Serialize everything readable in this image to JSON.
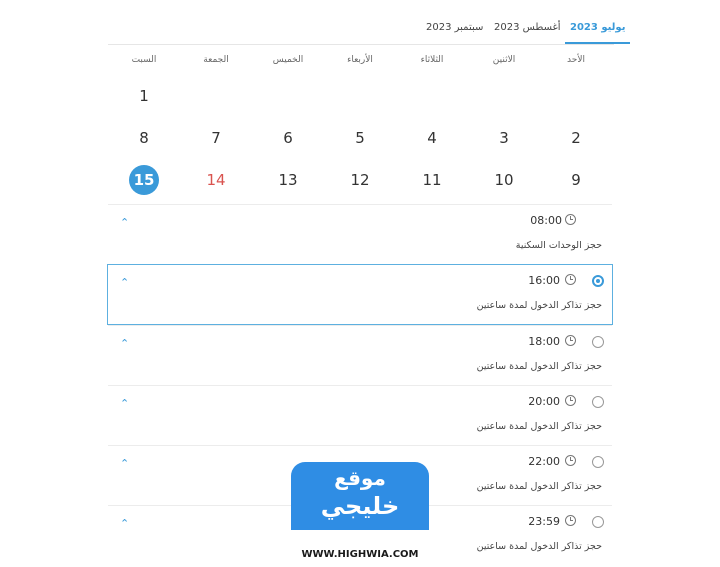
{
  "tabs": [
    {
      "label": "يوليو 2023",
      "active": true
    },
    {
      "label": "أغسطس 2023",
      "active": false
    },
    {
      "label": "سبتمبر 2023",
      "active": false
    }
  ],
  "weekdays": [
    "الأحد",
    "الاثنين",
    "الثلاثاء",
    "الأربعاء",
    "الخميس",
    "الجمعة",
    "السبت"
  ],
  "days": {
    "row1": [
      "1"
    ],
    "row2": [
      "2",
      "3",
      "4",
      "5",
      "6",
      "7",
      "8"
    ],
    "row3": [
      "9",
      "10",
      "11",
      "12",
      "13",
      "14",
      "15"
    ]
  },
  "today": "15",
  "slots": [
    {
      "time": "08:00",
      "desc": "حجز الوحدات السكنية",
      "selected": false,
      "radio": false
    },
    {
      "time": "16:00",
      "desc": "حجز تذاكر الدخول لمدة ساعتين",
      "selected": true,
      "radio": true
    },
    {
      "time": "18:00",
      "desc": "حجز تذاكر الدخول لمدة ساعتين",
      "selected": false,
      "radio": true
    },
    {
      "time": "20:00",
      "desc": "حجز تذاكر الدخول لمدة ساعتين",
      "selected": false,
      "radio": true
    },
    {
      "time": "22:00",
      "desc": "حجز تذاكر الدخول لمدة ساعتين",
      "selected": false,
      "radio": true
    },
    {
      "time": "23:59",
      "desc": "حجز تذاكر الدخول لمدة ساعتين",
      "selected": false,
      "radio": true
    }
  ],
  "watermark": {
    "line1": "موقع",
    "line2": "خليجي",
    "url": "WWW.HIGHWIA.COM"
  },
  "colors": {
    "accent": "#3a9ad9",
    "red_day": "#d9534f"
  }
}
